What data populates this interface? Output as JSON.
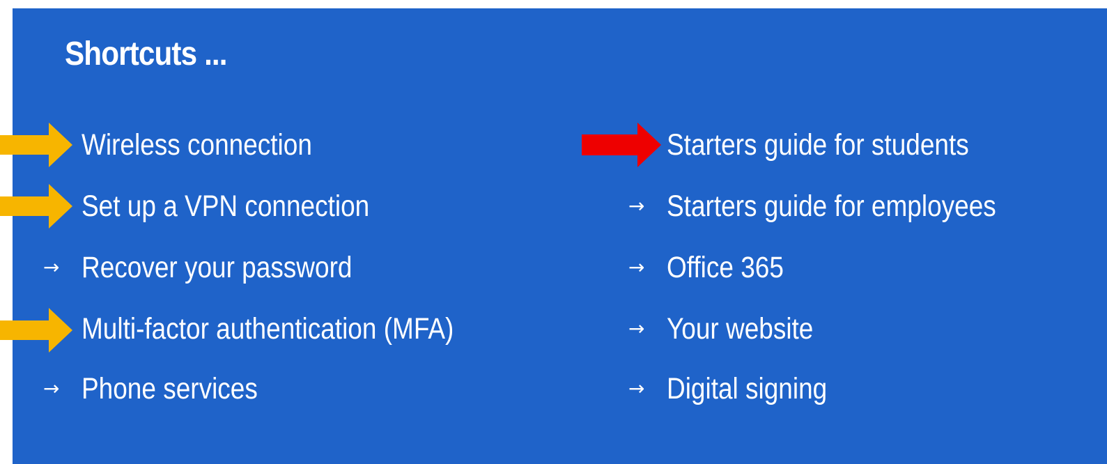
{
  "shortcuts": {
    "title": "Shortcuts ...",
    "left_column": [
      {
        "label": "Wireless connection",
        "arrow": "→",
        "highlight": "orange"
      },
      {
        "label": "Set up a VPN connection",
        "arrow": "→",
        "highlight": "orange"
      },
      {
        "label": "Recover your password",
        "arrow": "→",
        "highlight": "none"
      },
      {
        "label": "Multi-factor authentication (MFA)",
        "arrow": "→",
        "highlight": "orange"
      },
      {
        "label": "Phone services",
        "arrow": "→",
        "highlight": "none"
      }
    ],
    "right_column": [
      {
        "label": "Starters guide for students",
        "arrow": "→",
        "highlight": "red"
      },
      {
        "label": "Starters guide for employees",
        "arrow": "→",
        "highlight": "none"
      },
      {
        "label": "Office 365",
        "arrow": "→",
        "highlight": "none"
      },
      {
        "label": "Your website",
        "arrow": "→",
        "highlight": "none"
      },
      {
        "label": "Digital signing",
        "arrow": "→",
        "highlight": "none"
      }
    ]
  },
  "colors": {
    "panel_background": "#1f63c9",
    "text": "#ffffff",
    "annotation_orange": "#f7b500",
    "annotation_red": "#ee0000"
  }
}
